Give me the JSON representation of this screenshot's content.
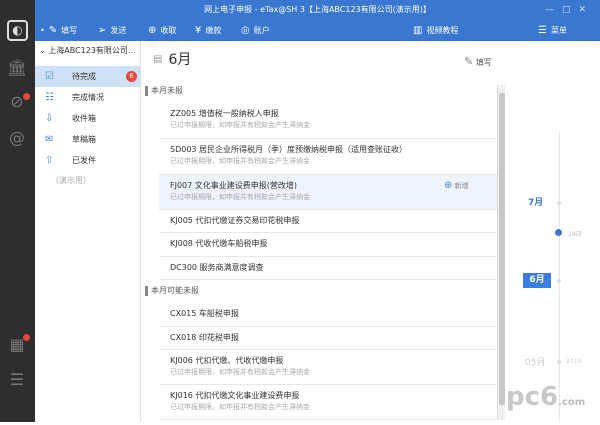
{
  "window": {
    "title": "网上电子申报 - eTax@SH 3【上海ABC123有限公司(演示用)】",
    "controls": [
      "—",
      "□",
      "✕"
    ]
  },
  "toolbar": {
    "items": [
      {
        "icon": "edit-icon",
        "label": "填写"
      },
      {
        "icon": "send-icon",
        "label": "发送"
      },
      {
        "icon": "download-icon",
        "label": "收取"
      },
      {
        "icon": "yen-icon",
        "label": "缴款"
      },
      {
        "icon": "user-icon",
        "label": "账户"
      }
    ],
    "video": "视频教程",
    "menu": "菜单"
  },
  "nav": {
    "company": "上海ABC123有限公司...",
    "items": [
      {
        "icon": "clipboard-check-icon",
        "label": "待完成",
        "badge": "6"
      },
      {
        "icon": "list-icon",
        "label": "完成情况"
      },
      {
        "icon": "inbox-icon",
        "label": "收件箱"
      },
      {
        "icon": "draft-icon",
        "label": "草稿箱"
      },
      {
        "icon": "upload-icon",
        "label": "已发件"
      }
    ],
    "demo": "（演示用）"
  },
  "main": {
    "month": "6月",
    "fill": "填写",
    "add": "新增",
    "sections": [
      {
        "title": "本月未报",
        "rows": [
          {
            "title": "ZZ005 增值税一般纳税人申报",
            "sub": "已过申报期限，如申报并有税款会产生滞纳金"
          },
          {
            "title": "SD003 居民企业所得税月（季）度预缴纳税申报（适用查账征收）",
            "sub": "已过申报期限，如申报并有税款会产生滞纳金"
          },
          {
            "title": "FJ007 文化事业建设费申报(营改增)",
            "sub": "已过申报期限，如申报并有税款会产生滞纳金"
          },
          {
            "title": "KJ005 代扣代缴证券交易印花税申报"
          },
          {
            "title": "KJ008 代收代缴车船税申报"
          },
          {
            "title": "DC300 服务商满意度调查"
          }
        ]
      },
      {
        "title": "本月可能未报",
        "rows": [
          {
            "title": "CX015 车船税申报"
          },
          {
            "title": "CX018 印花税申报"
          },
          {
            "title": "KJ006 代扣代缴、代收代缴申报",
            "sub": "已过申报期限，如申报并有税款会产生滞纳金"
          },
          {
            "title": "KJ016 代扣代缴文化事业建设费申报",
            "sub": "已过申报期限，如申报并有税款会产生滞纳金"
          }
        ]
      }
    ]
  },
  "timeline": {
    "m7": "7月",
    "day": "19日",
    "m6": "6月",
    "m5": "05月",
    "year": "2019"
  },
  "watermark": "pc6 下载站 .com",
  "colors": {
    "brand": "#3a77d0",
    "sidebar": "#2e2e2e",
    "badge": "#e8473b"
  }
}
